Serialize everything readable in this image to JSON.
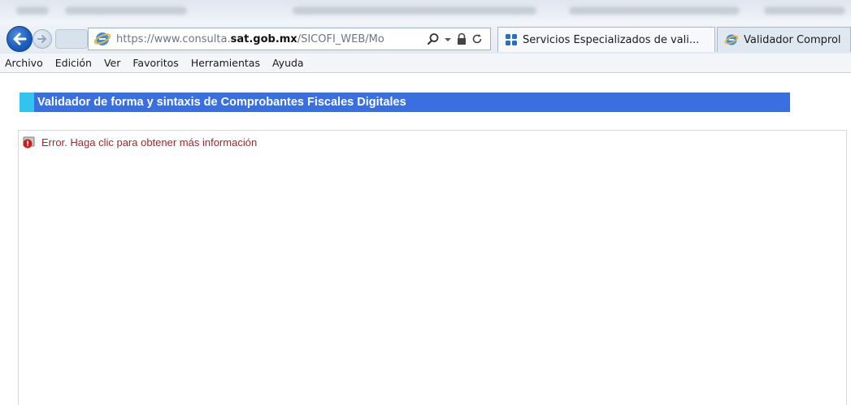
{
  "browser": {
    "address": {
      "url_prefix": "https://www.consulta.",
      "url_domain": "sat.gob.mx",
      "url_suffix": "/SICOFI_WEB/Mo"
    },
    "tabs": [
      {
        "label": "Servicios Especializados de vali...",
        "active": true,
        "icon": "grid-icon"
      },
      {
        "label": "Validador Comprol",
        "active": false,
        "icon": "ie-icon"
      }
    ],
    "menu": [
      "Archivo",
      "Edición",
      "Ver",
      "Favoritos",
      "Herramientas",
      "Ayuda"
    ]
  },
  "page": {
    "header_title": "Validador de forma y sintaxis de Comprobantes Fiscales Digitales",
    "error_message": "Error. Haga clic para obtener más información",
    "error_icon": "error-lock-icon"
  },
  "colors": {
    "header_band": "#3a6fe0",
    "header_accent": "#31c4ee",
    "error_text": "#a3262c"
  }
}
